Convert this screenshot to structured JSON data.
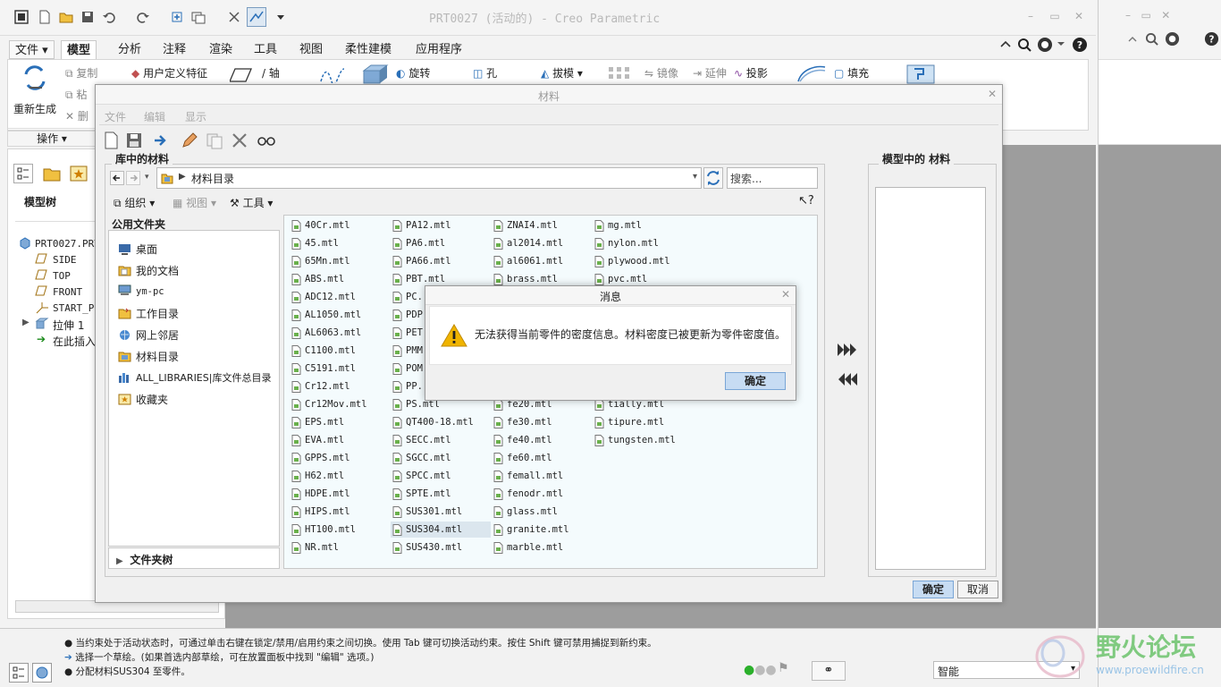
{
  "app": {
    "title": "PRT0027 (活动的) - Creo Parametric"
  },
  "ribbon": {
    "tabs": [
      "文件",
      "模型",
      "分析",
      "注释",
      "渲染",
      "工具",
      "视图",
      "柔性建模",
      "应用程序"
    ],
    "active_tab": "模型",
    "regenerate": "重新生成",
    "copy": "复制",
    "paste": "粘",
    "delete": "删",
    "user_feature": "用户定义特征",
    "axis": "轴",
    "revolve": "旋转",
    "hole": "孔",
    "draft": "拔模",
    "mirror": "镜像",
    "extend": "延伸",
    "project": "投影",
    "fill": "填充",
    "operations": "操作"
  },
  "model_tree": {
    "title": "模型树",
    "items": [
      "PRT0027.PRT",
      "SIDE",
      "TOP",
      "FRONT",
      "START_P",
      "拉伸 1",
      "在此插入"
    ]
  },
  "status": {
    "messages": [
      "当约束处于活动状态时，可通过单击右键在锁定/禁用/启用约束之间切换。使用 Tab 键可切换活动约束。按住 Shift 键可禁用捕捉到新约束。",
      "选择一个草绘。(如果首选内部草绘，可在放置面板中找到 \"编辑\" 选项。)",
      "分配材料SUS304 至零件。"
    ],
    "filter": "智能",
    "watermark_cn": "野火论坛",
    "watermark_url": "www.proewildfire.cn"
  },
  "materials_dialog": {
    "title": "材料",
    "menu": [
      "文件",
      "编辑",
      "显示"
    ],
    "library_label": "库中的材料",
    "address": "材料目录",
    "search_placeholder": "搜索...",
    "organize": "组织",
    "view": "视图",
    "tools": "工具",
    "common_folders_label": "公用文件夹",
    "favorites": [
      "桌面",
      "我的文档",
      "ym-pc",
      "工作目录",
      "网上邻居",
      "材料目录",
      "ALL_LIBRARIES|库文件总目录",
      "收藏夹"
    ],
    "folder_tree": "文件夹树",
    "model_materials_label": "模型中的 材料",
    "ok": "确定",
    "cancel": "取消",
    "files": [
      [
        "40Cr.mtl",
        "45.mtl",
        "65Mn.mtl",
        "ABS.mtl",
        "ADC12.mtl",
        "AL1050.mtl",
        "AL6063.mtl",
        "C1100.mtl",
        "C5191.mtl",
        "Cr12.mtl",
        "Cr12Mov.mtl",
        "EPS.mtl",
        "EVA.mtl",
        "GPPS.mtl",
        "H62.mtl",
        "HDPE.mtl",
        "HIPS.mtl",
        "HT100.mtl",
        "NR.mtl"
      ],
      [
        "PA12.mtl",
        "PA6.mtl",
        "PA66.mtl",
        "PBT.mtl",
        "PC.",
        "PDP",
        "PET",
        "PMM",
        "POM",
        "PP.",
        "PS.mtl",
        "QT400-18.mtl",
        "SECC.mtl",
        "SGCC.mtl",
        "SPCC.mtl",
        "SPTE.mtl",
        "SUS301.mtl",
        "SUS304.mtl",
        "SUS430.mtl"
      ],
      [
        "ZNAI4.mtl",
        "al2014.mtl",
        "al6061.mtl",
        "brass.mtl",
        "",
        "",
        "",
        "",
        "",
        "",
        "fe20.mtl",
        "fe30.mtl",
        "fe40.mtl",
        "fe60.mtl",
        "femall.mtl",
        "fenodr.mtl",
        "glass.mtl",
        "granite.mtl",
        "marble.mtl"
      ],
      [
        "mg.mtl",
        "nylon.mtl",
        "plywood.mtl",
        "pvc.mtl",
        "",
        "",
        "",
        "",
        "",
        "",
        "tially.mtl",
        "tipure.mtl",
        "tungsten.mtl",
        "",
        "",
        "",
        "",
        "",
        ""
      ]
    ],
    "selected_file": "SUS304.mtl"
  },
  "message_box": {
    "title": "消息",
    "text": "无法获得当前零件的密度信息。材料密度已被更新为零件密度值。",
    "ok": "确定"
  }
}
